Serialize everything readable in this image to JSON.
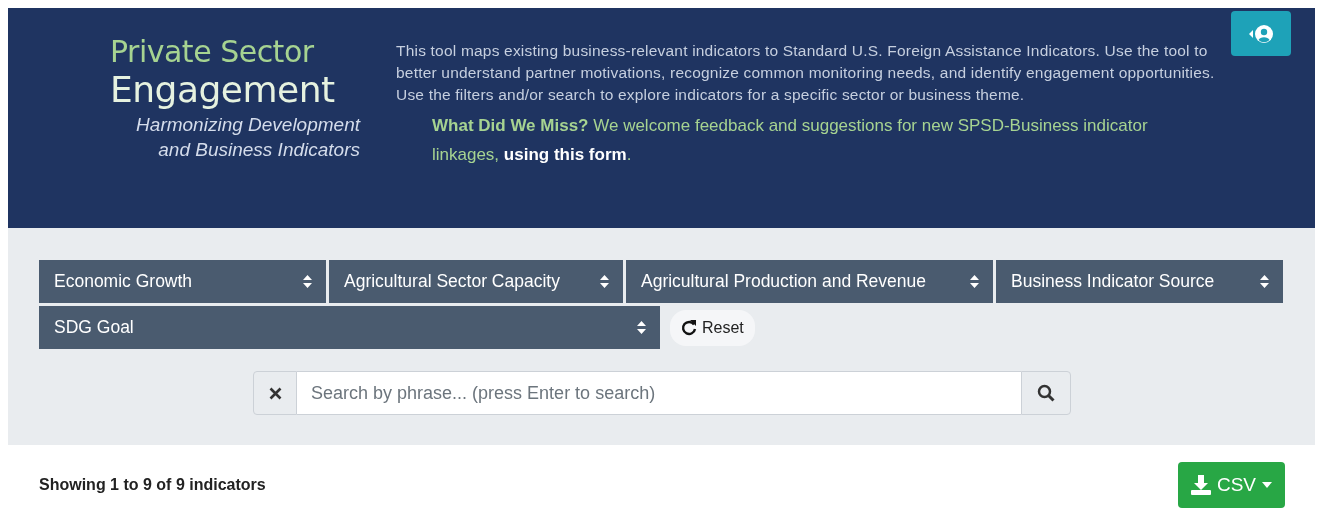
{
  "header": {
    "title_top": "Private Sector",
    "title_main": "Engagement",
    "subtitle": "Harmonizing Development and Business Indicators",
    "description": "This tool maps existing business-relevant indicators to Standard U.S. Foreign Assistance Indicators. Use the tool to better understand partner motivations, recognize common monitoring needs, and identify engagement opportunities. Use the filters and/or search to explore indicators for a specific sector or business theme.",
    "feedback": {
      "lead": "What Did We Miss?",
      "text": "We welcome feedback and suggestions for new SPSD-Business indicator linkages,",
      "link": "using this form",
      "end": "."
    }
  },
  "filters": [
    {
      "label": "Economic Growth"
    },
    {
      "label": "Agricultural Sector Capacity"
    },
    {
      "label": "Agricultural Production and Revenue"
    },
    {
      "label": "Business Indicator Source"
    },
    {
      "label": "SDG Goal"
    }
  ],
  "reset_button": {
    "label": "Reset"
  },
  "search": {
    "placeholder": "Search by phrase... (press Enter to search)"
  },
  "result_count": "Showing 1 to 9 of 9 indicators",
  "export_button": {
    "label": "CSV"
  }
}
